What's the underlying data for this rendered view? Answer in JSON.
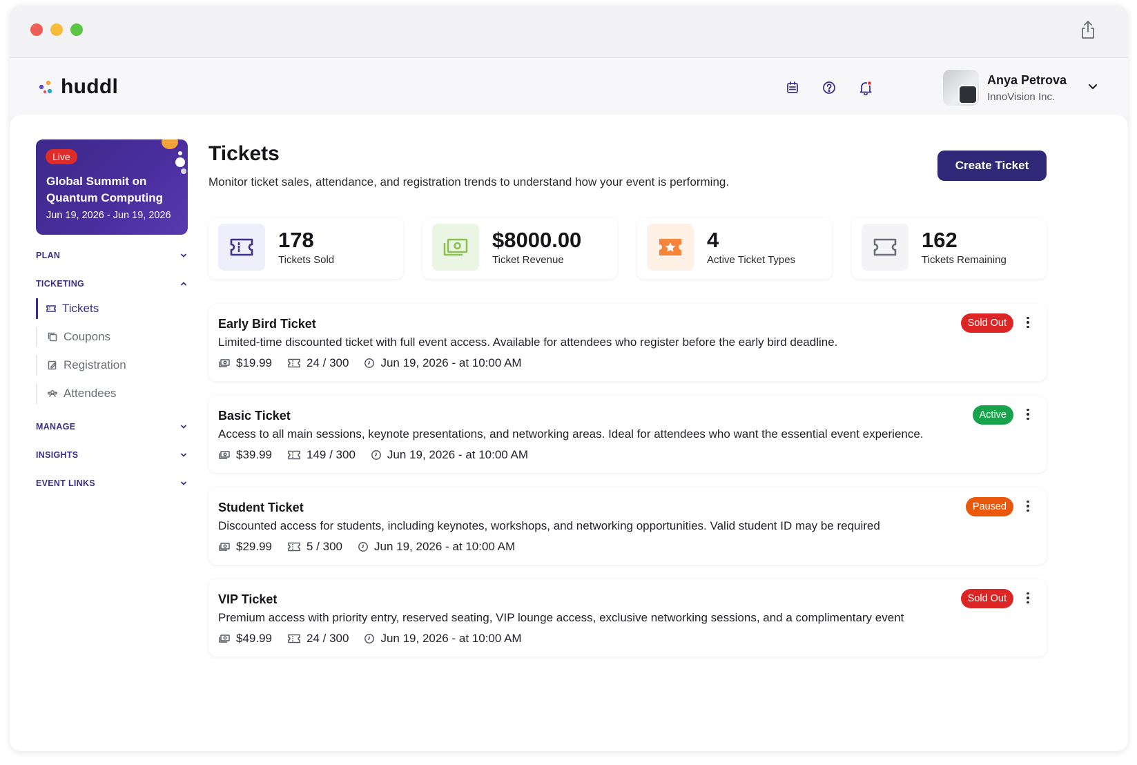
{
  "app": {
    "name": "huddl"
  },
  "colors": {
    "brand": "#2f2877",
    "nav_accent": "#3c2f88",
    "sold_out": "#dc2626",
    "active": "#16a34a",
    "paused": "#ea580c"
  },
  "header": {
    "icons": [
      "calendar-icon",
      "help-icon",
      "bell-icon"
    ],
    "user": {
      "name": "Anya Petrova",
      "org": "InnoVision Inc."
    }
  },
  "event": {
    "status": "Live",
    "title": "Global Summit on Quantum Computing",
    "date": "Jun 19, 2026 - Jun 19, 2026"
  },
  "sidebar": {
    "plan": "PLAN",
    "ticketing": "TICKETING",
    "items": [
      {
        "label": "Tickets"
      },
      {
        "label": "Coupons"
      },
      {
        "label": "Registration"
      },
      {
        "label": "Attendees"
      }
    ],
    "manage": "MANAGE",
    "insights": "INSIGHTS",
    "event_links": "EVENT LINKS"
  },
  "page": {
    "title": "Tickets",
    "subtitle": "Monitor ticket sales, attendance, and registration trends to understand how your event is performing.",
    "create_button": "Create Ticket"
  },
  "stats": [
    {
      "value": "178",
      "label": "Tickets Sold"
    },
    {
      "value": "$8000.00",
      "label": "Ticket Revenue"
    },
    {
      "value": "4",
      "label": "Active Ticket Types"
    },
    {
      "value": "162",
      "label": "Tickets Remaining"
    }
  ],
  "tickets": [
    {
      "name": "Early Bird Ticket",
      "status": "Sold Out",
      "description": "Limited-time discounted ticket with full event access. Available for attendees who register before the early bird deadline.",
      "price": "$19.99",
      "sold": "24 / 300",
      "date": "Jun 19, 2026 - at 10:00 AM"
    },
    {
      "name": "Basic Ticket",
      "status": "Active",
      "description": "Access to all main sessions, keynote presentations, and networking areas. Ideal for attendees who want the essential event experience.",
      "price": "$39.99",
      "sold": "149 / 300",
      "date": "Jun 19, 2026 - at 10:00 AM"
    },
    {
      "name": "Student Ticket",
      "status": "Paused",
      "description": "Discounted access for students, including keynotes, workshops, and networking opportunities. Valid student ID may be required",
      "price": "$29.99",
      "sold": "5 / 300",
      "date": "Jun 19, 2026 - at 10:00 AM"
    },
    {
      "name": "VIP Ticket",
      "status": "Sold Out",
      "description": "Premium access with priority entry, reserved seating, VIP lounge access, exclusive networking sessions, and a complimentary event",
      "price": "$49.99",
      "sold": "24 / 300",
      "date": "Jun 19, 2026 - at 10:00 AM"
    }
  ]
}
